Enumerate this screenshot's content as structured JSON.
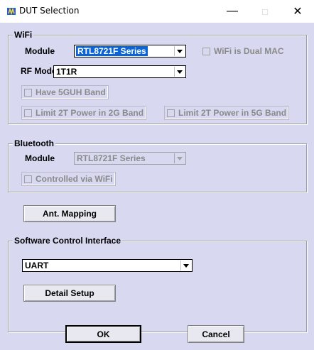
{
  "window": {
    "title": "DUT Selection",
    "controls": {
      "minimize": "—",
      "maximize": "□",
      "close": "✕"
    }
  },
  "wifi": {
    "group_label": "WiFi",
    "module_label": "Module",
    "module_value": "RTL8721F Series",
    "dual_mac_label": "WiFi is Dual MAC",
    "rf_mode_label": "RF Mode",
    "rf_mode_value": "1T1R",
    "have_5guh_label": "Have 5GUH Band",
    "limit_2g_label": "Limit 2T Power in 2G Band",
    "limit_5g_label": "Limit 2T Power in 5G Band"
  },
  "bluetooth": {
    "group_label": "Bluetooth",
    "module_label": "Module",
    "module_value": "RTL8721F Series",
    "controlled_via_wifi_label": "Controlled via WiFi"
  },
  "ant_mapping_label": "Ant. Mapping",
  "software": {
    "group_label": "Software Control Interface",
    "interface_value": "UART",
    "detail_setup_label": "Detail Setup"
  },
  "footer": {
    "ok_label": "OK",
    "cancel_label": "Cancel"
  }
}
